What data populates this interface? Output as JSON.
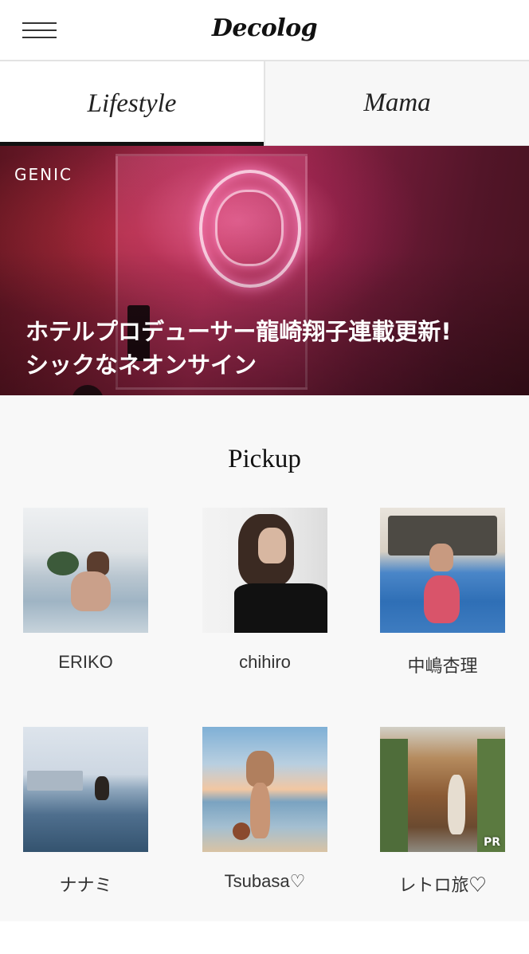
{
  "header": {
    "logo": "Decolog"
  },
  "tabs": [
    {
      "label": "Lifestyle",
      "active": true
    },
    {
      "label": "Mama",
      "active": false
    }
  ],
  "hero": {
    "tag": "GENIC",
    "title_line1": "ホテルプロデューサー龍崎翔子連載更新!",
    "title_line2": "シックなネオンサイン"
  },
  "pickup": {
    "title": "Pickup",
    "items": [
      {
        "label": "ERIKO"
      },
      {
        "label": "chihiro"
      },
      {
        "label": "中嶋杏理"
      },
      {
        "label": "ナナミ"
      },
      {
        "label": "Tsubasa♡"
      },
      {
        "label": "レトロ旅♡",
        "badge": "PR"
      }
    ]
  }
}
